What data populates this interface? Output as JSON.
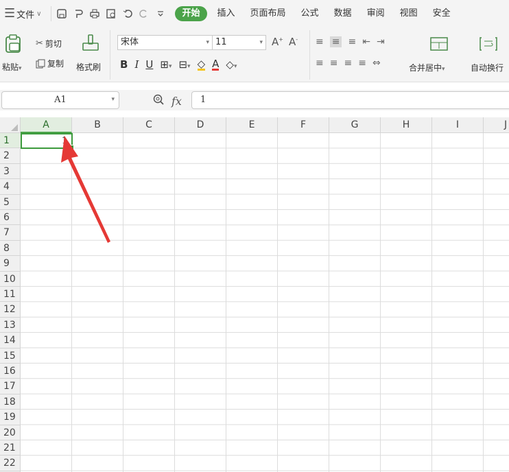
{
  "menubar": {
    "file_label": "文件",
    "tabs": [
      "开始",
      "插入",
      "页面布局",
      "公式",
      "数据",
      "审阅",
      "视图",
      "安全"
    ]
  },
  "ribbon": {
    "paste_label": "粘贴",
    "cut_label": "剪切",
    "copy_label": "复制",
    "format_painter_label": "格式刷",
    "font_name": "宋体",
    "font_size": "11",
    "bold": "B",
    "italic": "I",
    "underline": "U",
    "merge_center_label": "合并居中",
    "wrap_text_label": "自动换行"
  },
  "formula_bar": {
    "cell_ref": "A1",
    "fx_label": "fx",
    "content": "1"
  },
  "grid": {
    "columns": [
      "A",
      "B",
      "C",
      "D",
      "E",
      "F",
      "G",
      "H",
      "I",
      "J"
    ],
    "rows": [
      "1",
      "2",
      "3",
      "4",
      "5",
      "6",
      "7",
      "8",
      "9",
      "10",
      "11",
      "12",
      "13",
      "14",
      "15",
      "16",
      "17",
      "18",
      "19",
      "20",
      "21",
      "22"
    ],
    "selected_cell": "A1",
    "a1_value": "1"
  },
  "colors": {
    "accent": "#4ba34a",
    "arrow": "#e53935"
  }
}
